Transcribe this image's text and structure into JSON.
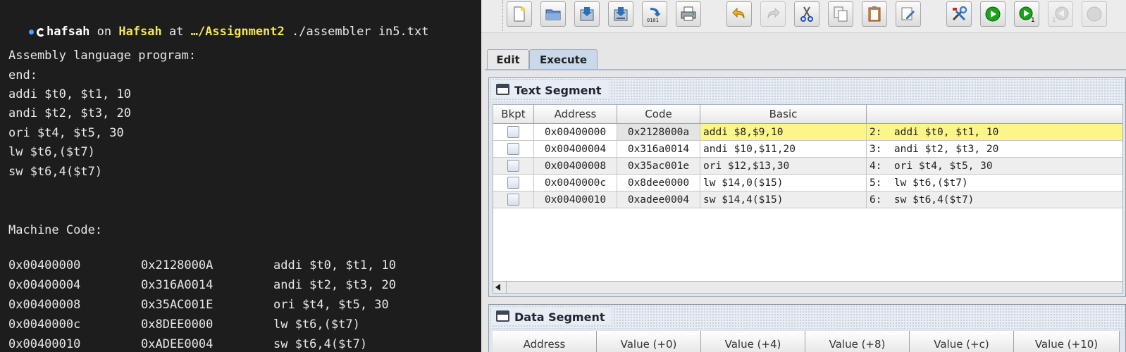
{
  "terminal": {
    "prompt": {
      "user": "hafsah",
      "on_word": " on ",
      "host": "Hafsah",
      "at_word": " at ",
      "path": "…/Assignment2",
      "command": " ./assembler in5.txt"
    },
    "program_heading": "Assembly language program:",
    "program_lines": [
      "end:",
      "addi $t0, $t1, 10",
      "andi $t2, $t3, 20",
      "ori $t4, $t5, 30",
      "lw $t6,($t7)",
      "sw $t6,4($t7)"
    ],
    "machine_heading": "Machine Code:",
    "machine_rows": [
      {
        "address": "0x00400000",
        "code": "0x2128000A",
        "instr": "addi $t0, $t1, 10"
      },
      {
        "address": "0x00400004",
        "code": "0x316A0014",
        "instr": "andi $t2, $t3, 20"
      },
      {
        "address": "0x00400008",
        "code": "0x35AC001E",
        "instr": "ori $t4, $t5, 30"
      },
      {
        "address": "0x0040000c",
        "code": "0x8DEE0000",
        "instr": "lw $t6,($t7)"
      },
      {
        "address": "0x00400010",
        "code": "0xADEE0004",
        "instr": "sw $t6,4($t7)"
      }
    ]
  },
  "ide": {
    "toolbar": {
      "buttons": [
        "new-file",
        "open-folder",
        "save",
        "save-as",
        "dump-memory",
        "print",
        "undo",
        "redo",
        "cut",
        "copy",
        "paste",
        "find-replace",
        "assemble",
        "run",
        "step",
        "backstep"
      ],
      "step_sub": "1",
      "backstep_sub": "1",
      "dump_label": "0101"
    },
    "tabs": {
      "edit": "Edit",
      "execute": "Execute"
    },
    "text_segment": {
      "title": "Text Segment",
      "columns": [
        "Bkpt",
        "Address",
        "Code",
        "Basic",
        ""
      ],
      "rows": [
        {
          "address": "0x00400000",
          "code": "0x2128000a",
          "basic": "addi $8,$9,10",
          "source": "2:  addi $t0, $t1, 10",
          "highlighted": true
        },
        {
          "address": "0x00400004",
          "code": "0x316a0014",
          "basic": "andi $10,$11,20",
          "source": "3:  andi $t2, $t3, 20",
          "highlighted": false
        },
        {
          "address": "0x00400008",
          "code": "0x35ac001e",
          "basic": "ori $12,$13,30",
          "source": "4:  ori $t4, $t5, 30",
          "highlighted": false
        },
        {
          "address": "0x0040000c",
          "code": "0x8dee0000",
          "basic": "lw $14,0($15)",
          "source": "5:  lw $t6,($t7)",
          "highlighted": false
        },
        {
          "address": "0x00400010",
          "code": "0xadee0004",
          "basic": "sw $14,4($15)",
          "source": "6:  sw $t6,4($t7)",
          "highlighted": false
        }
      ]
    },
    "data_segment": {
      "title": "Data Segment",
      "columns": [
        "Address",
        "Value (+0)",
        "Value (+4)",
        "Value (+8)",
        "Value (+c)",
        "Value (+10)"
      ]
    },
    "colors": {
      "highlight_row": "#fcf58a",
      "tab_active": "#c9d9ea",
      "run_green": "#1aa31a"
    }
  }
}
